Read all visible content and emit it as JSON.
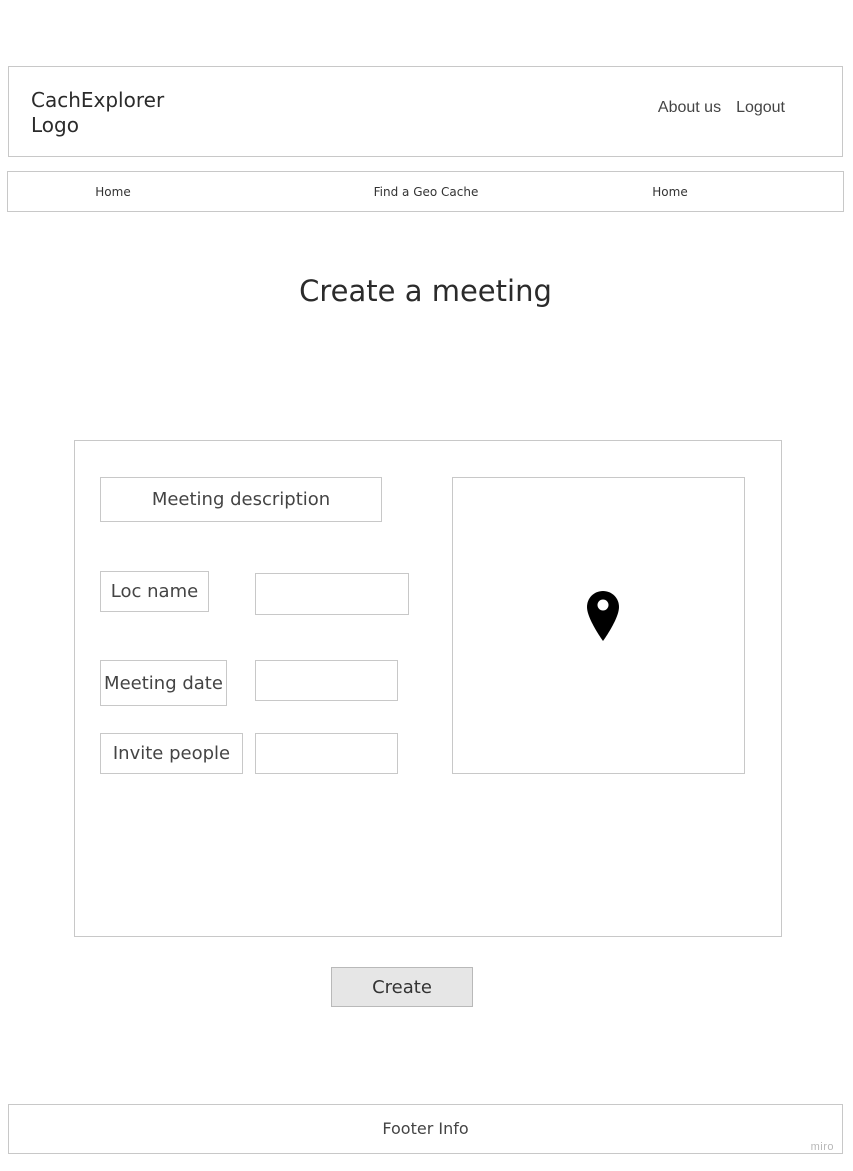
{
  "header": {
    "logo": "CachExplorer Logo",
    "links": [
      "About us",
      "Logout"
    ]
  },
  "nav": {
    "items": [
      "Home",
      "Find a Geo Cache",
      "Home"
    ]
  },
  "page": {
    "title": "Create a meeting"
  },
  "form": {
    "description_label": "Meeting description",
    "loc_name_label": "Loc name",
    "loc_name_value": "",
    "meeting_date_label": "Meeting date",
    "meeting_date_value": "",
    "invite_people_label": "Invite people",
    "invite_people_value": ""
  },
  "map": {
    "icon": "map-pin-icon"
  },
  "actions": {
    "create_label": "Create"
  },
  "footer": {
    "text": "Footer Info"
  },
  "watermark": "miro"
}
